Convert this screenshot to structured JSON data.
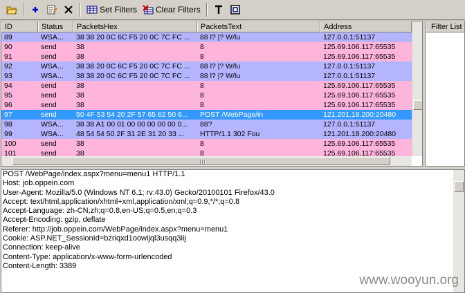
{
  "toolbar": {
    "set_filters_label": "Set Filters",
    "clear_filters_label": "Clear Filters"
  },
  "grid": {
    "columns": [
      "ID",
      "Status",
      "PacketsHex",
      "PacketsText",
      "Address"
    ],
    "rows": [
      {
        "id": "89",
        "status": "WSA...",
        "hex": "38 38 20 0C 6C F5 20 0C 7C FC ...",
        "text": "88  l?  |?  W/lu",
        "addr": "127.0.0.1:51137",
        "kind": "wsa"
      },
      {
        "id": "90",
        "status": "send",
        "hex": "38",
        "text": "8",
        "addr": "125.69.106.117:65535",
        "kind": "send"
      },
      {
        "id": "91",
        "status": "send",
        "hex": "38",
        "text": "8",
        "addr": "125.69.106.117:65535",
        "kind": "send"
      },
      {
        "id": "92",
        "status": "WSA...",
        "hex": "38 38 20 0C 6C F5 20 0C 7C FC ...",
        "text": "88  l?  |?  W/lu",
        "addr": "127.0.0.1:51137",
        "kind": "wsa"
      },
      {
        "id": "93",
        "status": "WSA...",
        "hex": "38 38 20 0C 6C F5 20 0C 7C FC ...",
        "text": "88  l?  |?  W/lu",
        "addr": "127.0.0.1:51137",
        "kind": "wsa"
      },
      {
        "id": "94",
        "status": "send",
        "hex": "38",
        "text": "8",
        "addr": "125.69.106.117:65535",
        "kind": "send"
      },
      {
        "id": "95",
        "status": "send",
        "hex": "38",
        "text": "8",
        "addr": "125.69.106.117:65535",
        "kind": "send"
      },
      {
        "id": "96",
        "status": "send",
        "hex": "38",
        "text": "8",
        "addr": "125.69.106.117:65535",
        "kind": "send"
      },
      {
        "id": "97",
        "status": "send",
        "hex": "50 4F 53 54 20 2F 57 65 62 50 6...",
        "text": "POST /WebPage/in",
        "addr": "121.201.18.200:20480",
        "kind": "sel"
      },
      {
        "id": "98",
        "status": "WSA...",
        "hex": "38 38 A1 00 01 00 00 00 00 00 0...",
        "text": "88?",
        "addr": "127.0.0.1:51137",
        "kind": "wsa"
      },
      {
        "id": "99",
        "status": "WSA...",
        "hex": "48 54 54 50 2F 31 2E 31 20 33 ...",
        "text": "HTTP/1.1 302 Fou",
        "addr": "121.201.18.200:20480",
        "kind": "wsa"
      },
      {
        "id": "100",
        "status": "send",
        "hex": "38",
        "text": "8",
        "addr": "125.69.106.117:65535",
        "kind": "send"
      },
      {
        "id": "101",
        "status": "send",
        "hex": "38",
        "text": "8",
        "addr": "125.69.106.117:65535",
        "kind": "send"
      }
    ]
  },
  "filter_panel": {
    "title": "Filter List"
  },
  "detail": {
    "lines": [
      "POST /WebPage/index.aspx?menu=menu1 HTTP/1.1",
      "Host: job.oppein.com",
      "User-Agent: Mozilla/5.0 (Windows NT 6.1; rv:43.0) Gecko/20100101 Firefox/43.0",
      "Accept: text/html,application/xhtml+xml,application/xml;q=0.9,*/*;q=0.8",
      "Accept-Language: zh-CN,zh;q=0.8,en-US;q=0.5,en;q=0.3",
      "Accept-Encoding: gzip, deflate",
      "Referer: http://job.oppein.com/WebPage/index.aspx?menu=menu1",
      "Cookie: ASP.NET_SessionId=bzriqxd1oowijql3usqq3iij",
      "Connection: keep-alive",
      "Content-Type: application/x-www-form-urlencoded",
      "Content-Length: 3389"
    ]
  },
  "watermark": "www.wooyun.org",
  "colors": {
    "wsa_row": "#b4b4ff",
    "send_row": "#ffb4dc",
    "selected_row": "#3399ff"
  }
}
